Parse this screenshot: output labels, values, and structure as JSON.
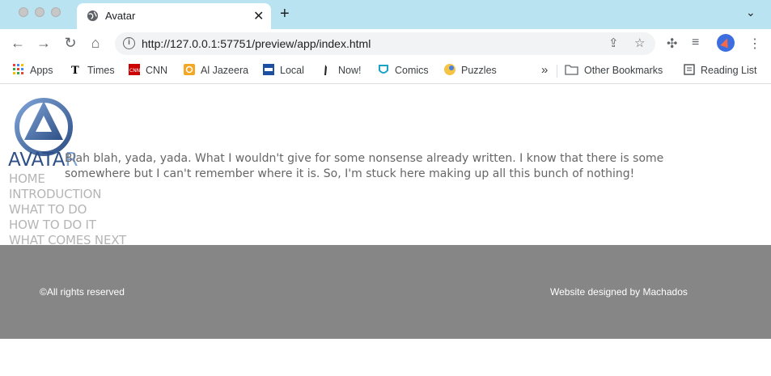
{
  "browser": {
    "tab_title": "Avatar",
    "url": "http://127.0.0.1:57751/preview/app/index.html",
    "bookmarks": [
      "Apps",
      "Times",
      "CNN",
      "Al Jazeera",
      "Local",
      "Now!",
      "Comics",
      "Puzzles"
    ],
    "other_bookmarks": "Other Bookmarks",
    "reading_list": "Reading List",
    "overflow": "»"
  },
  "site": {
    "logo_text_dark": "AVATA",
    "logo_text_light": "R",
    "nav": [
      "HOME",
      "INTRODUCTION",
      "WHAT TO DO",
      "HOW TO DO IT",
      "WHAT COMES NEXT"
    ],
    "body_text": "Blah blah, yada, yada. What I wouldn't give for some nonsense already written. I know that there is some somewhere but I can't remember where it is. So, I'm stuck here making up all this bunch of nothing!",
    "footer_left": "©All rights reserved",
    "footer_right": "Website designed by Machados"
  },
  "colors": {
    "tab_strip": "#b9e3f0",
    "logo_blue": "#2d4f86",
    "nav_gray": "#b5b5b5",
    "footer_bg": "#868686"
  }
}
